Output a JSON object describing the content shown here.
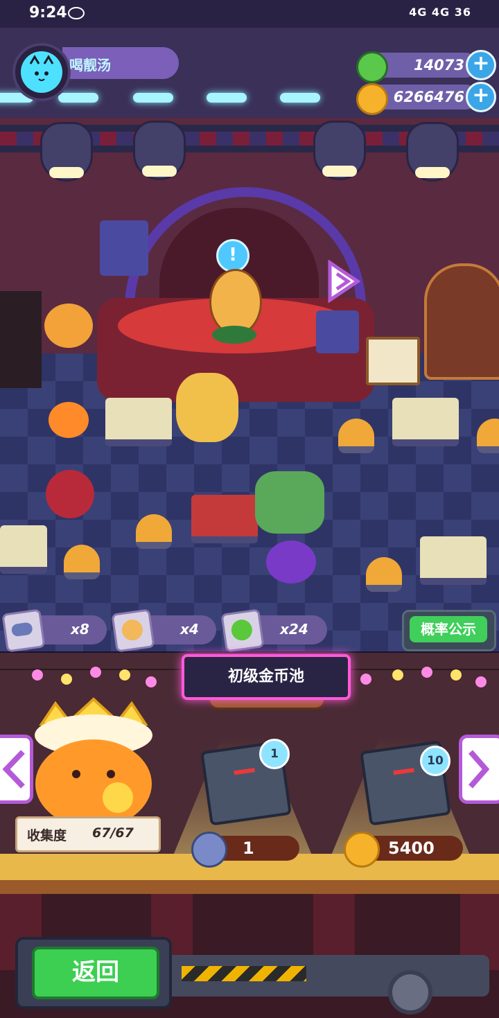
{
  "status_bar": {
    "time": "9:24",
    "right_text": "4G 4G 36"
  },
  "player": {
    "name": "喝靓汤"
  },
  "currencies": [
    {
      "icon": "green-donut-icon",
      "value": "14073"
    },
    {
      "icon": "gold-planet-coin-icon",
      "value": "6266476"
    }
  ],
  "stage": {
    "alert": "!"
  },
  "items": [
    {
      "icon": "blue-capsule-icon",
      "count": "x8"
    },
    {
      "icon": "gold-cookie-icon",
      "count": "x4"
    },
    {
      "icon": "green-gear-icon",
      "count": "x24"
    }
  ],
  "probability_button": "概率公示",
  "pool": {
    "title": "初级金币池",
    "collection_label": "收集度",
    "collection_value": "67/67",
    "draws": [
      {
        "badge": "1",
        "cost_icon": "blue-capsule-icon",
        "cost": "1"
      },
      {
        "badge": "10",
        "cost_icon": "gold-planet-coin-icon",
        "cost": "5400"
      }
    ]
  },
  "back_button": "返回",
  "colors": {
    "accent_pink": "#ff5ad8",
    "green_button": "#3ccf52",
    "purple_hud": "#7b5fb8"
  }
}
